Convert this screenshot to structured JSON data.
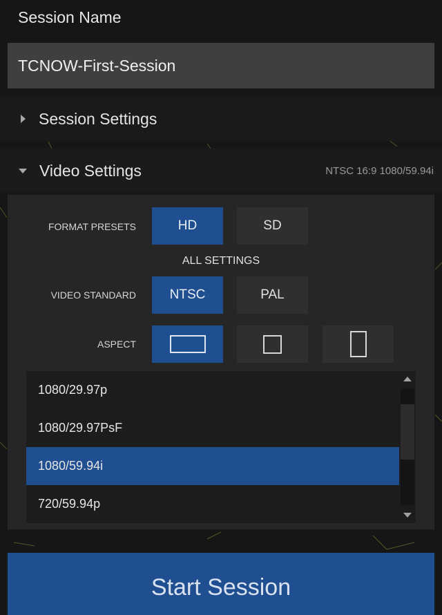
{
  "session": {
    "name_label": "Session Name",
    "name_value": "TCNOW-First-Session"
  },
  "session_settings": {
    "label": "Session Settings",
    "expanded": false
  },
  "video_settings": {
    "label": "Video Settings",
    "summary": "NTSC 16:9 1080/59.94i",
    "expanded": true,
    "format_presets": {
      "label": "FORMAT PRESETS",
      "options": [
        "HD",
        "SD"
      ],
      "selected": "HD"
    },
    "all_settings_label": "ALL SETTINGS",
    "video_standard": {
      "label": "VIDEO STANDARD",
      "options": [
        "NTSC",
        "PAL"
      ],
      "selected": "NTSC"
    },
    "aspect": {
      "label": "ASPECT",
      "options": [
        "aspect-16x9-icon",
        "aspect-4x3-icon",
        "aspect-portrait-icon"
      ],
      "selected": "aspect-16x9-icon"
    },
    "resolutions": {
      "items": [
        "1080/29.97p",
        "1080/29.97PsF",
        "1080/59.94i",
        "720/59.94p"
      ],
      "selected": "1080/59.94i"
    }
  },
  "start_button": {
    "label": "Start Session"
  },
  "colors": {
    "accent": "#1f4f91",
    "panel": "#262626",
    "field": "#3f3f3f",
    "background": "#161616"
  }
}
